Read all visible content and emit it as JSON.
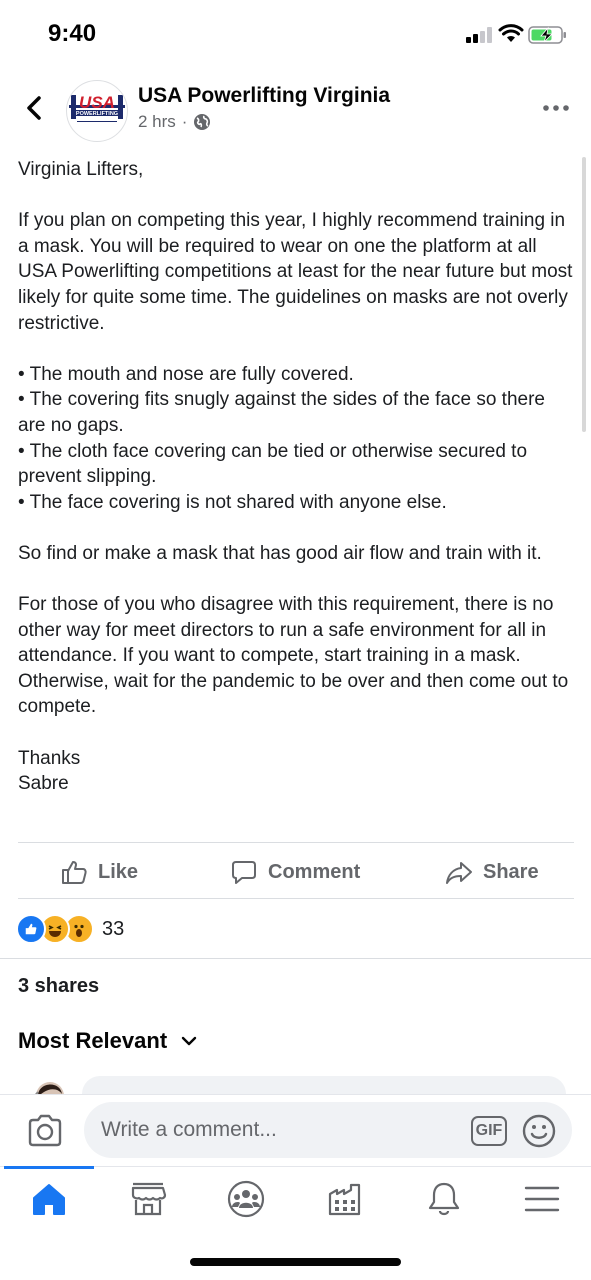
{
  "status_bar": {
    "time": "9:40"
  },
  "post": {
    "page_name": "USA Powerlifting Virginia",
    "timestamp": "2 hrs",
    "separator": "·",
    "avatar_icon": "usa-powerlifting-logo",
    "avatar_text": "USA",
    "avatar_subtext": "POWERLIFTING",
    "paragraphs": [
      "Virginia Lifters,",
      "",
      "If you plan on competing this year, I highly recommend training in a mask.  You will be required to wear on one the platform at all USA Powerlifting competitions at least for the near future but most likely for quite some time.  The guidelines on masks are not overly restrictive.",
      "",
      "• The mouth and nose are fully covered.",
      "• The covering fits snugly against the sides of the face so there are no gaps.",
      "• The cloth face covering can be tied or otherwise secured to prevent slipping.",
      "• The face covering is not shared with anyone else.",
      "",
      "So find or make a mask that has good air flow and train with it.",
      "",
      "For those of you who disagree with this requirement, there is no other way for meet directors to run a safe environment for all in attendance.  If you want to compete, start training in a mask.  Otherwise, wait for the pandemic to be over and then come out to compete.",
      "",
      "Thanks",
      "Sabre"
    ]
  },
  "actions": {
    "like": "Like",
    "comment": "Comment",
    "share": "Share"
  },
  "reactions": {
    "count": "33",
    "types": [
      "like",
      "haha",
      "wow"
    ]
  },
  "shares_text": "3 shares",
  "comments_sort": "Most Relevant",
  "composer": {
    "placeholder": "Write a comment...",
    "gif_label": "GIF"
  },
  "tabs": [
    "home-icon",
    "marketplace-icon",
    "groups-icon",
    "pages-icon",
    "notifications-icon",
    "menu-icon"
  ],
  "colors": {
    "accent": "#1877f2",
    "secondary_text": "#65676b",
    "bubble": "#f0f2f5",
    "like_blue": "#1877f2",
    "emoji_yellow": "#f7b125"
  }
}
